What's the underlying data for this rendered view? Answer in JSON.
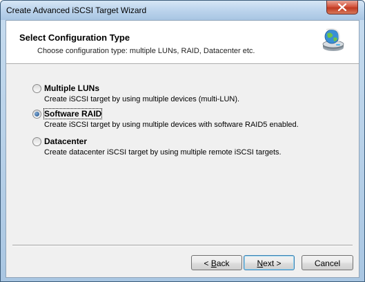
{
  "window": {
    "title": "Create Advanced iSCSI Target Wizard"
  },
  "header": {
    "title": "Select Configuration Type",
    "subtitle": "Choose configuration type: multiple LUNs, RAID, Datacenter etc.",
    "icon": "network-drive-icon"
  },
  "options": [
    {
      "label": "Multiple LUNs",
      "description": "Create iSCSI target by using multiple devices (multi-LUN).",
      "selected": false
    },
    {
      "label": "Software RAID",
      "description": "Create iSCSI target by using multiple devices with software RAID5 enabled.",
      "selected": true
    },
    {
      "label": "Datacenter",
      "description": "Create datacenter iSCSI target by using multiple remote iSCSI targets.",
      "selected": false
    }
  ],
  "buttons": {
    "back": {
      "prefix": "< ",
      "mnemonic": "B",
      "rest": "ack"
    },
    "next": {
      "mnemonic": "N",
      "rest": "ext >"
    },
    "cancel": "Cancel"
  }
}
